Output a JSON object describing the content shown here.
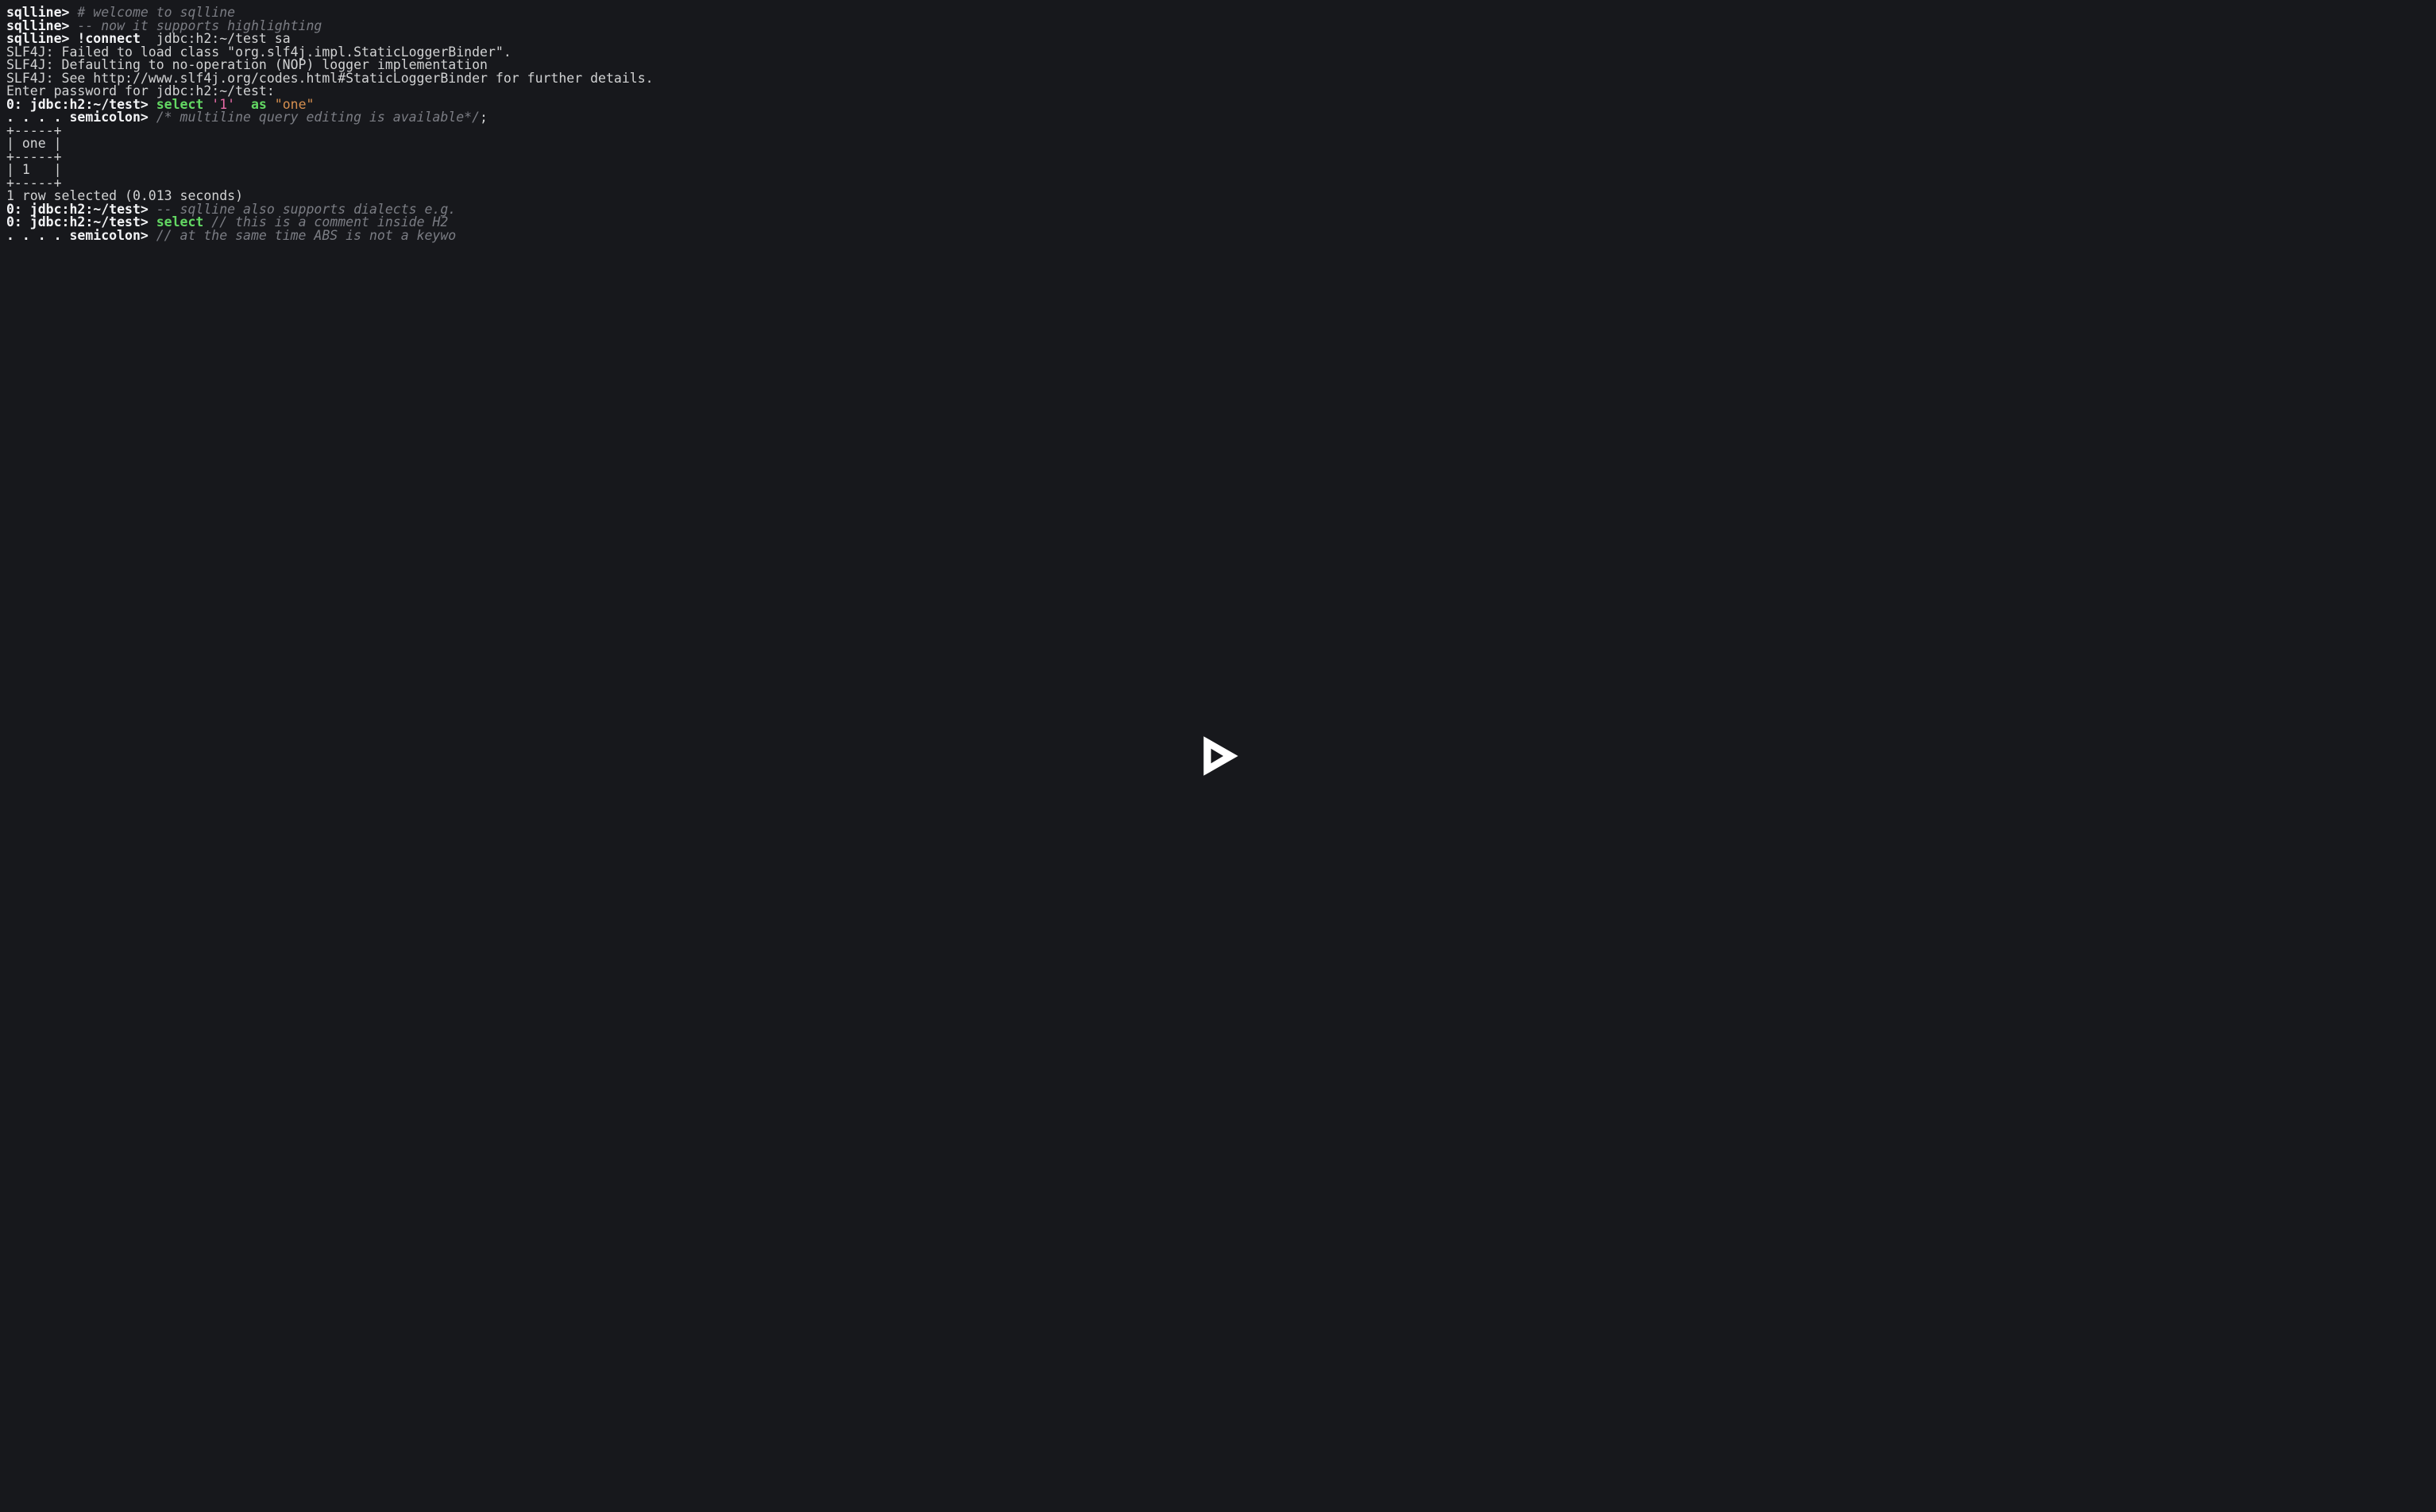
{
  "colors": {
    "background": "#17181c",
    "foreground": "#d2d3d4",
    "prompt": "#f3f4f6",
    "dim": "#7b7d84",
    "keyword": "#63d863",
    "literal": "#e96ba8",
    "string": "#d68f4f"
  },
  "prompts": {
    "sqlline": "sqlline> ",
    "jdbc": "0: jdbc:h2:~/test> ",
    "cont": ". . . . semicolon> "
  },
  "lines": [
    {
      "segments": [
        {
          "cls": "c-prompt",
          "key": "prompts.sqlline"
        },
        {
          "cls": "c-dim",
          "text": "# welcome to sqlline"
        }
      ]
    },
    {
      "segments": [
        {
          "cls": "c-prompt",
          "key": "prompts.sqlline"
        },
        {
          "cls": "c-dim",
          "text": "-- now it supports highlighting"
        }
      ]
    },
    {
      "segments": [
        {
          "cls": "c-prompt",
          "key": "prompts.sqlline"
        },
        {
          "cls": "c-cmd",
          "text": "!connect"
        },
        {
          "cls": "c-args",
          "text": "  jdbc:h2:~/test sa"
        }
      ]
    },
    {
      "segments": [
        {
          "cls": "c-plain",
          "text": "SLF4J: Failed to load class \"org.slf4j.impl.StaticLoggerBinder\"."
        }
      ]
    },
    {
      "segments": [
        {
          "cls": "c-plain",
          "text": "SLF4J: Defaulting to no-operation (NOP) logger implementation"
        }
      ]
    },
    {
      "segments": [
        {
          "cls": "c-plain",
          "text": "SLF4J: See http://www.slf4j.org/codes.html#StaticLoggerBinder for further details."
        }
      ]
    },
    {
      "segments": [
        {
          "cls": "c-plain",
          "text": "Enter password for jdbc:h2:~/test:"
        }
      ]
    },
    {
      "segments": [
        {
          "cls": "c-prompt",
          "key": "prompts.jdbc"
        },
        {
          "cls": "c-kw",
          "text": "select "
        },
        {
          "cls": "c-literal",
          "text": "'1'"
        },
        {
          "cls": "c-plain",
          "text": "  "
        },
        {
          "cls": "c-kw",
          "text": "as "
        },
        {
          "cls": "c-string",
          "text": "\"one\""
        }
      ]
    },
    {
      "segments": [
        {
          "cls": "c-prompt",
          "key": "prompts.cont"
        },
        {
          "cls": "c-dim",
          "text": "/* multiline query editing is available*/"
        },
        {
          "cls": "c-plain",
          "text": ";"
        }
      ]
    },
    {
      "segments": [
        {
          "cls": "c-plain",
          "text": "+-----+"
        }
      ]
    },
    {
      "segments": [
        {
          "cls": "c-plain",
          "text": "| one |"
        }
      ]
    },
    {
      "segments": [
        {
          "cls": "c-plain",
          "text": "+-----+"
        }
      ]
    },
    {
      "segments": [
        {
          "cls": "c-plain",
          "text": "| 1   |"
        }
      ]
    },
    {
      "segments": [
        {
          "cls": "c-plain",
          "text": "+-----+"
        }
      ]
    },
    {
      "segments": [
        {
          "cls": "c-plain",
          "text": "1 row selected (0.013 seconds)"
        }
      ]
    },
    {
      "segments": [
        {
          "cls": "c-prompt",
          "key": "prompts.jdbc"
        },
        {
          "cls": "c-dim",
          "text": "-- sqlline also supports dialects e.g."
        }
      ]
    },
    {
      "segments": [
        {
          "cls": "c-prompt",
          "key": "prompts.jdbc"
        },
        {
          "cls": "c-kw",
          "text": "select "
        },
        {
          "cls": "c-dim",
          "text": "// this is a comment inside H2"
        }
      ]
    },
    {
      "segments": [
        {
          "cls": "c-prompt",
          "key": "prompts.cont"
        },
        {
          "cls": "c-dim",
          "text": "// at the same time ABS is not a keywo"
        }
      ]
    }
  ],
  "play_button_label": "Play"
}
